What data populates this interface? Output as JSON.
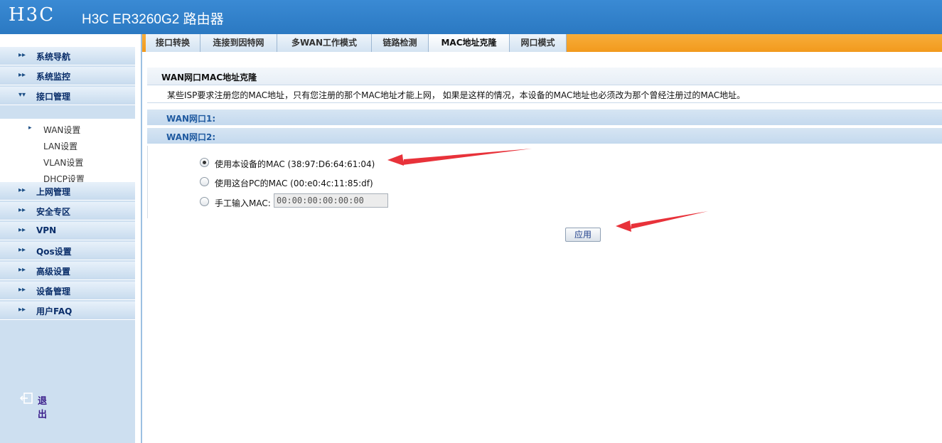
{
  "header": {
    "logo_text": "H3C",
    "title": "H3C ER3260G2 路由器"
  },
  "sidebar": {
    "items": [
      {
        "label": "系统导航"
      },
      {
        "label": "系统监控"
      },
      {
        "label": "接口管理"
      },
      {
        "label": "上网管理"
      },
      {
        "label": "安全专区"
      },
      {
        "label": "VPN"
      },
      {
        "label": "Qos设置"
      },
      {
        "label": "高级设置"
      },
      {
        "label": "设备管理"
      },
      {
        "label": "用户FAQ"
      }
    ],
    "sub_items": [
      {
        "label": "WAN设置"
      },
      {
        "label": "LAN设置"
      },
      {
        "label": "VLAN设置"
      },
      {
        "label": "DHCP设置"
      }
    ],
    "logout_label": "退出"
  },
  "tabs": [
    {
      "label": "接口转换"
    },
    {
      "label": "连接到因特网"
    },
    {
      "label": "多WAN工作模式"
    },
    {
      "label": "链路检测"
    },
    {
      "label": "MAC地址克隆"
    },
    {
      "label": "网口模式"
    }
  ],
  "main": {
    "section_title": "WAN网口MAC地址克隆",
    "description": "某些ISP要求注册您的MAC地址，只有您注册的那个MAC地址才能上网， 如果是这样的情况，本设备的MAC地址也必须改为那个曾经注册过的MAC地址。",
    "wan1_label": "WAN网口1:",
    "wan2_label": "WAN网口2:",
    "options": [
      {
        "label": "使用本设备的MAC (38:97:D6:64:61:04)",
        "checked": true
      },
      {
        "label": "使用这台PC的MAC (00:e0:4c:11:85:df)",
        "checked": false
      },
      {
        "label": "手工输入MAC:",
        "checked": false
      }
    ],
    "manual_mac_value": "00:00:00:00:00:00",
    "apply_label": "应用"
  },
  "colors": {
    "header_bg": "#2f7fc8",
    "tabbar_bg": "#f29a1d",
    "annotation_arrow": "#e8323a"
  }
}
